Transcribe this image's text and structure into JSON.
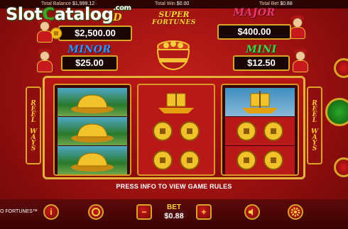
{
  "top_bar": {
    "balance_label": "Total Balance",
    "balance_value": "$1,999.12",
    "win_label": "Total Win",
    "win_value": "$0.00",
    "bet_label": "Total Bet",
    "bet_value": "$0.88"
  },
  "watermark": {
    "text_a": "Slot",
    "text_c": "C",
    "text_b": "atalog",
    "suffix": ".com"
  },
  "game_title": {
    "line1": "SUPER",
    "line2": "FORTUNES"
  },
  "jackpots": {
    "grand": {
      "label": "D",
      "value": "$2,500.00",
      "color": "#ffcf2e"
    },
    "major": {
      "label": "MAJOR",
      "value": "$400.00",
      "color": "#e8396a"
    },
    "minor": {
      "label": "MINOR",
      "value": "$25.00",
      "color": "#3f8ff0"
    },
    "mini": {
      "label": "MINI",
      "value": "$12.50",
      "color": "#46d04a"
    }
  },
  "reel_side_label": "REEL WAYS",
  "reels": [
    [
      "gold-ingot-pile",
      "gold-ingot-pile",
      "gold-ingot-pile"
    ],
    [
      "gold-ship",
      "gold-coins",
      "gold-coins"
    ],
    [
      "gold-ship",
      "gold-coins",
      "gold-coins"
    ]
  ],
  "info_message": "PRESS INFO TO VIEW GAME RULES",
  "bottom_bar": {
    "game_name": "O FORTUNES™",
    "info_icon": "i",
    "bet_label": "BET",
    "bet_value": "$0.88",
    "minus_icon": "−",
    "plus_icon": "+"
  },
  "colors": {
    "frame_gold": "#d9a526",
    "background_red": "#b81616"
  }
}
